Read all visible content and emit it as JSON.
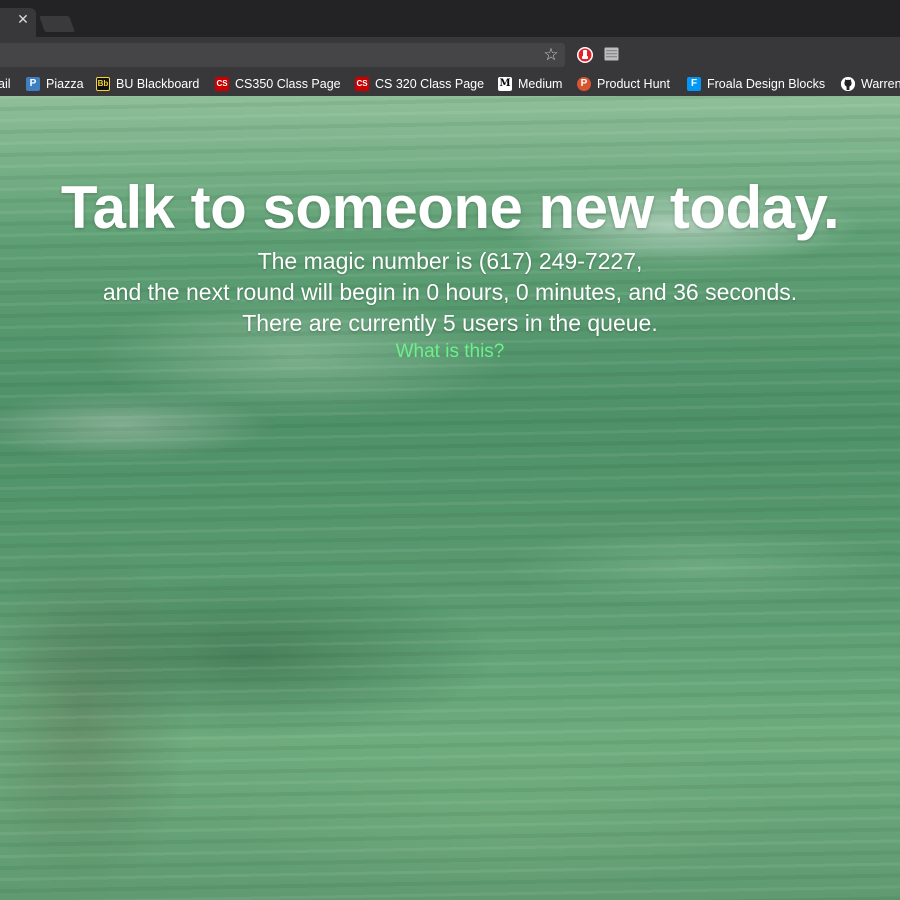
{
  "browser": {
    "tab_close_glyph": "✕",
    "bookmarks": [
      {
        "label": "ail",
        "icon": "gmail-icon"
      },
      {
        "label": "Piazza",
        "icon": "piazza-icon",
        "badge": "P",
        "color": "#3e7fc1"
      },
      {
        "label": "BU Blackboard",
        "icon": "blackboard-icon",
        "badge": "Bb",
        "color": "#000000"
      },
      {
        "label": "CS350 Class Page",
        "icon": "cs-icon",
        "badge": "CS",
        "color": "#cc0000"
      },
      {
        "label": "CS 320 Class Page",
        "icon": "cs-icon",
        "badge": "CS",
        "color": "#cc0000"
      },
      {
        "label": "Medium",
        "icon": "medium-icon",
        "badge": "M",
        "color": "#000000"
      },
      {
        "label": "Product Hunt",
        "icon": "product-hunt-icon",
        "badge": "P",
        "color": "#da552f"
      },
      {
        "label": "Froala Design Blocks",
        "icon": "froala-icon",
        "badge": "F",
        "color": "#0098f7"
      },
      {
        "label": "Warren",
        "icon": "github-icon"
      }
    ]
  },
  "page": {
    "headline": "Talk to someone new today.",
    "magic_number_line": "The magic number is (617) 249-7227,",
    "countdown_line": "and the next round will begin in 0 hours, 0 minutes, and 36 seconds.",
    "queue_line": "There are currently 5 users in the queue.",
    "info_link": "What is this?"
  },
  "colors": {
    "link": "#6cf08a",
    "chrome_dark": "#232325",
    "chrome_toolbar": "#38383b"
  }
}
